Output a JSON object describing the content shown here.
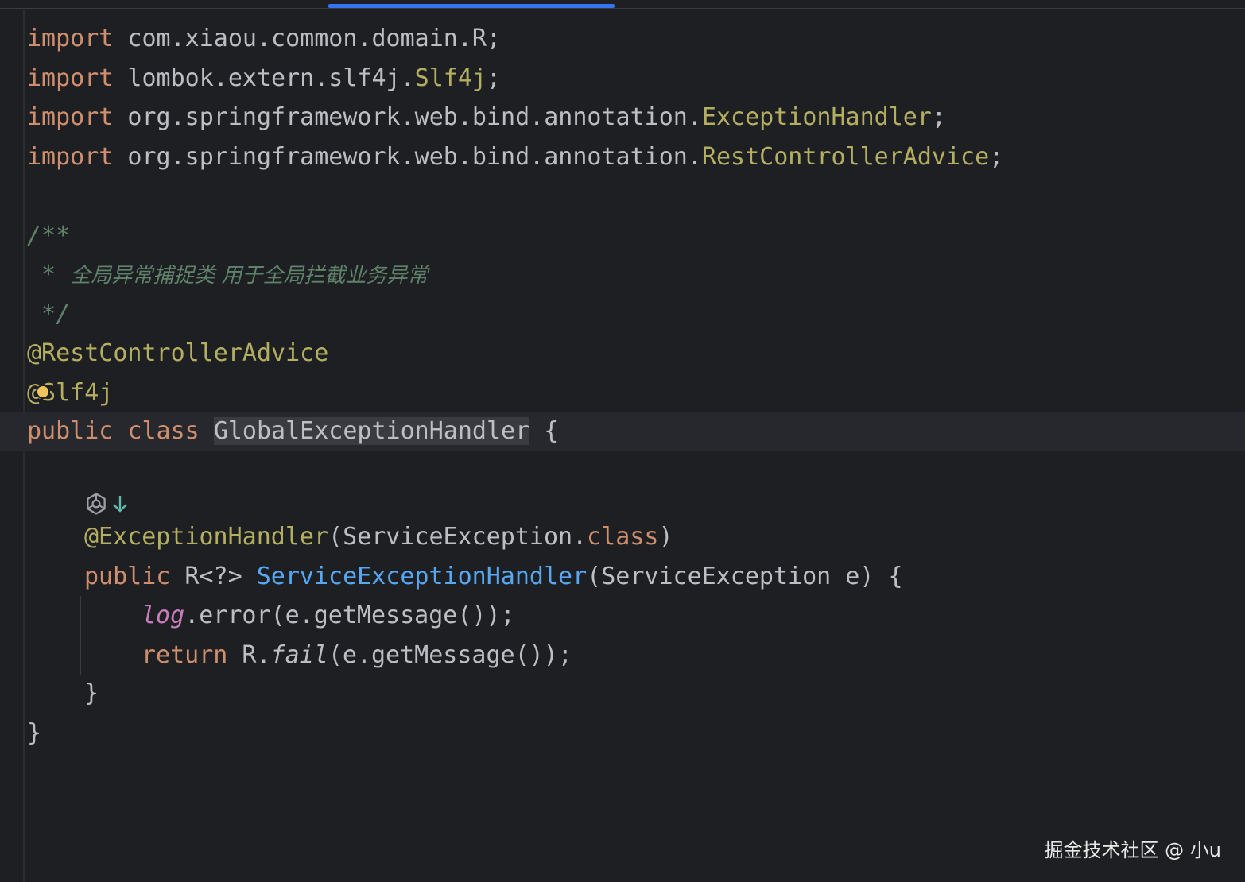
{
  "code": {
    "kw_import": "import",
    "line1_rest": " com.xiaou.common.domain.R;",
    "line2_pkg": " lombok.extern.slf4j.",
    "line2_cls": "Slf4j",
    "line2_end": ";",
    "line3_pkg": " org.springframework.web.bind.annotation.",
    "line3_cls": "ExceptionHandler",
    "line3_end": ";",
    "line4_pkg": " org.springframework.web.bind.annotation.",
    "line4_cls": "RestControllerAdvice",
    "line4_end": ";",
    "comment_open": "/**",
    "comment_star": " * ",
    "comment_text": "全局异常捕捉类 用于全局拦截业务异常",
    "comment_close": " */",
    "ann_rest": "@RestControllerAdvice",
    "ann_slf4j": "@Slf4j",
    "kw_public": "public",
    "kw_class": "class",
    "class_name": "GlobalExceptionHandler",
    "open_brace": " {",
    "ann_exh": "@ExceptionHandler",
    "exh_arg_open": "(ServiceException.",
    "exh_arg_class": "class",
    "exh_arg_close": ")",
    "method_ret": " R<?> ",
    "method_name": "ServiceExceptionHandler",
    "method_params": "(ServiceException e) {",
    "log_field": "log",
    "log_call": ".error(e.getMessage());",
    "kw_return": "return",
    "ret_r": " R.",
    "ret_fail": "fail",
    "ret_rest": "(e.getMessage());",
    "close_method": "}",
    "close_class": "}"
  },
  "watermark": "掘金技术社区 @ 小u",
  "icons": {
    "bulb": "lightbulb-icon",
    "gear": "gear-icon",
    "arrow": "down-arrow-icon"
  },
  "colors": {
    "background": "#1e1f22",
    "keyword": "#cf8e6d",
    "annotation": "#b3ae60",
    "method": "#56a8f5",
    "field": "#c77dbb",
    "comment": "#5f826b",
    "text": "#bcbec4",
    "accent": "#3574f0"
  }
}
